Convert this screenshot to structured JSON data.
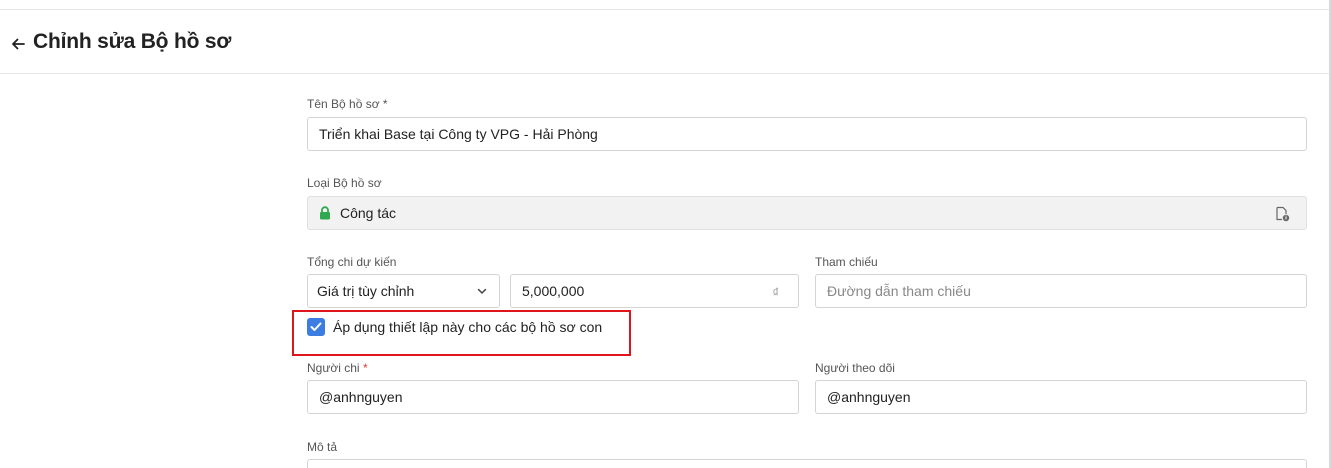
{
  "header": {
    "title": "Chỉnh sửa Bộ hồ sơ",
    "back_icon": "arrow-left-icon"
  },
  "form": {
    "name": {
      "label": "Tên Bộ hồ sơ",
      "required_mark": "*",
      "value": "Triển khai Base tại Công ty VPG - Hải Phòng"
    },
    "type": {
      "label": "Loại Bộ hồ sơ",
      "value": "Công tác",
      "lock_icon": "lock-icon",
      "lock_color": "#2fa84f",
      "info_icon": "document-info-icon"
    },
    "budget": {
      "label": "Tổng chi dự kiến",
      "mode_value": "Giá trị tùy chỉnh",
      "amount": "5,000,000",
      "currency": "₫"
    },
    "reference": {
      "label": "Tham chiếu",
      "placeholder": "Đường dẫn tham chiếu"
    },
    "apply_children": {
      "label": "Áp dụng thiết lập này cho các bộ hồ sơ con",
      "checked": true,
      "color": "#3b7de0"
    },
    "spender": {
      "label": "Người chi",
      "required_mark": "*",
      "value": "@anhnguyen"
    },
    "follower": {
      "label": "Người theo dõi",
      "value": "@anhnguyen"
    },
    "description": {
      "label": "Mô tả"
    }
  },
  "annotation": {
    "highlight_color": "#e0141b"
  }
}
